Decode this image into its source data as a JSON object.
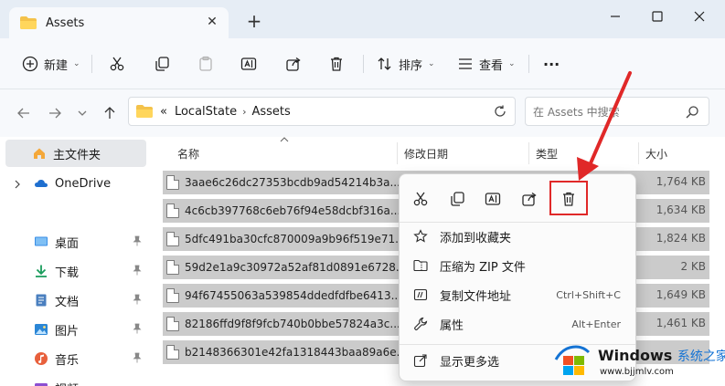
{
  "colors": {
    "accent": "#1473d4",
    "annotation": "#e02828",
    "selected_row": "#cbcbcb"
  },
  "window": {
    "tab_title": "Assets",
    "new_tab_symbol": "+",
    "close_tab_symbol": "✕"
  },
  "toolbar": {
    "new_label": "新建",
    "sort_label": "排序",
    "view_label": "查看",
    "more_label": "···"
  },
  "address": {
    "overflow": "«",
    "crumbs": [
      "LocalState",
      "Assets"
    ],
    "search_placeholder": "在 Assets 中搜索"
  },
  "sidebar": {
    "items": [
      {
        "label": "主文件夹",
        "icon": "home-icon"
      },
      {
        "label": "OneDrive",
        "icon": "cloud-icon"
      },
      {
        "label": "桌面",
        "icon": "desktop-icon"
      },
      {
        "label": "下载",
        "icon": "download-icon"
      },
      {
        "label": "文档",
        "icon": "document-icon"
      },
      {
        "label": "图片",
        "icon": "picture-icon"
      },
      {
        "label": "音乐",
        "icon": "music-icon"
      },
      {
        "label": "视频",
        "icon": "video-icon"
      }
    ]
  },
  "columns": {
    "name": "名称",
    "modified": "修改日期",
    "type": "类型",
    "size": "大小"
  },
  "files": [
    {
      "name": "3aae6c26dc27353bcdb9ad54214b3a...",
      "size": "1,764 KB"
    },
    {
      "name": "4c6cb397768c6eb76f94e58dcbf316a...",
      "size": "1,634 KB"
    },
    {
      "name": "5dfc491ba30cfc870009a9b96f519e71...",
      "size": "1,824 KB"
    },
    {
      "name": "59d2e1a9c30972a52af81d0891e6728...",
      "size": "2 KB"
    },
    {
      "name": "94f67455063a539854ddedfdfbe6413...",
      "size": "1,649 KB"
    },
    {
      "name": "82186ffd9f8f9fcb740b0bbe57824a3c...",
      "size": "1,461 KB"
    },
    {
      "name": "b2148366301e42fa1318443baa89a6e...",
      "size": ""
    }
  ],
  "context_menu": {
    "quick_actions": [
      "cut-icon",
      "copy-icon",
      "rename-icon",
      "share-icon",
      "delete-icon"
    ],
    "items": [
      {
        "label": "添加到收藏夹",
        "shortcut": ""
      },
      {
        "label": "压缩为 ZIP 文件",
        "shortcut": ""
      },
      {
        "label": "复制文件地址",
        "shortcut": "Ctrl+Shift+C"
      },
      {
        "label": "属性",
        "shortcut": "Alt+Enter"
      },
      {
        "label": "显示更多选",
        "shortcut": ""
      }
    ]
  },
  "watermark": {
    "title": "Windows",
    "subtitle": "系统之家",
    "url": "www.bjjmlv.com"
  }
}
